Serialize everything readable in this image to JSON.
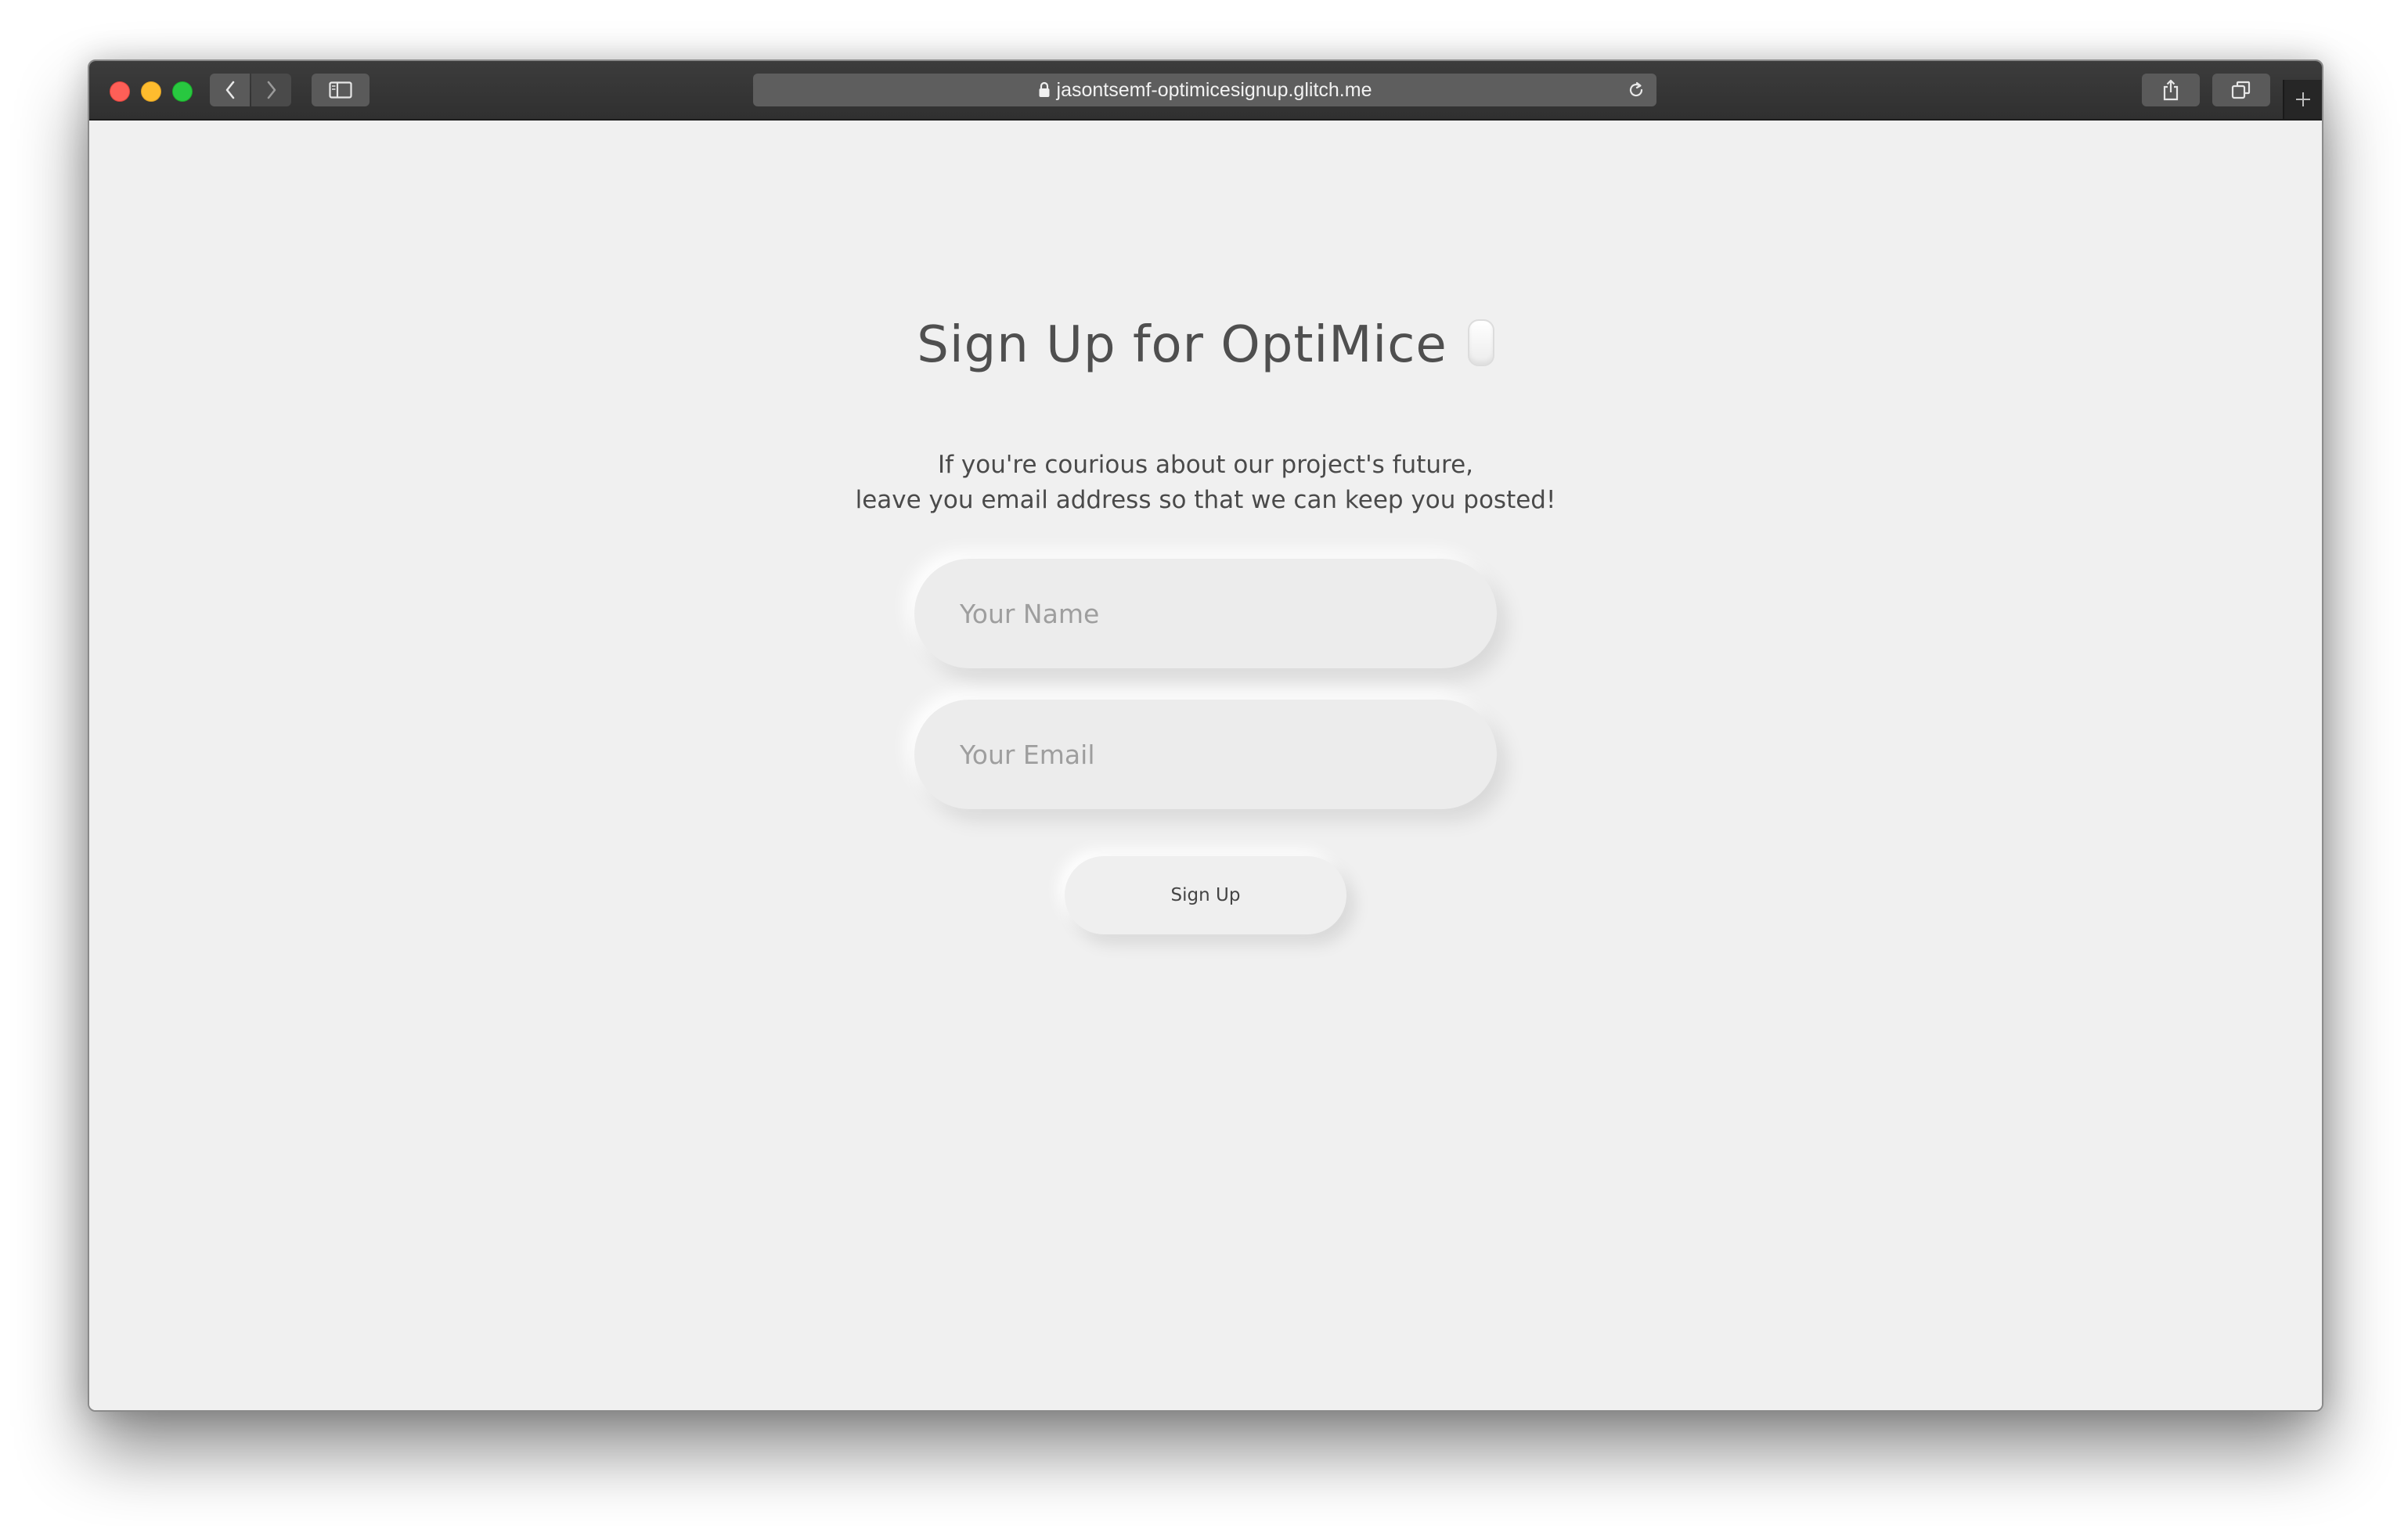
{
  "browser": {
    "url": "jasontsemf-optimicesignup.glitch.me",
    "toolbar_icons": [
      "back-arrow-icon",
      "forward-arrow-icon",
      "sidebar-icon",
      "lock-icon",
      "reload-icon",
      "share-icon",
      "tabs-overview-icon",
      "new-tab-plus-icon"
    ]
  },
  "page": {
    "title": "Sign Up for OptiMice",
    "title_icon": "mouse-icon",
    "subtitle_line1": "If you're courious about our project's future,",
    "subtitle_line2": "leave you email address so that we can keep you posted!",
    "name_placeholder": "Your Name",
    "email_placeholder": "Your Email",
    "signup_label": "Sign Up"
  },
  "colors": {
    "background": "#f0f0f0",
    "text": "#4f4f4f",
    "placeholder": "#9e9e9e"
  }
}
